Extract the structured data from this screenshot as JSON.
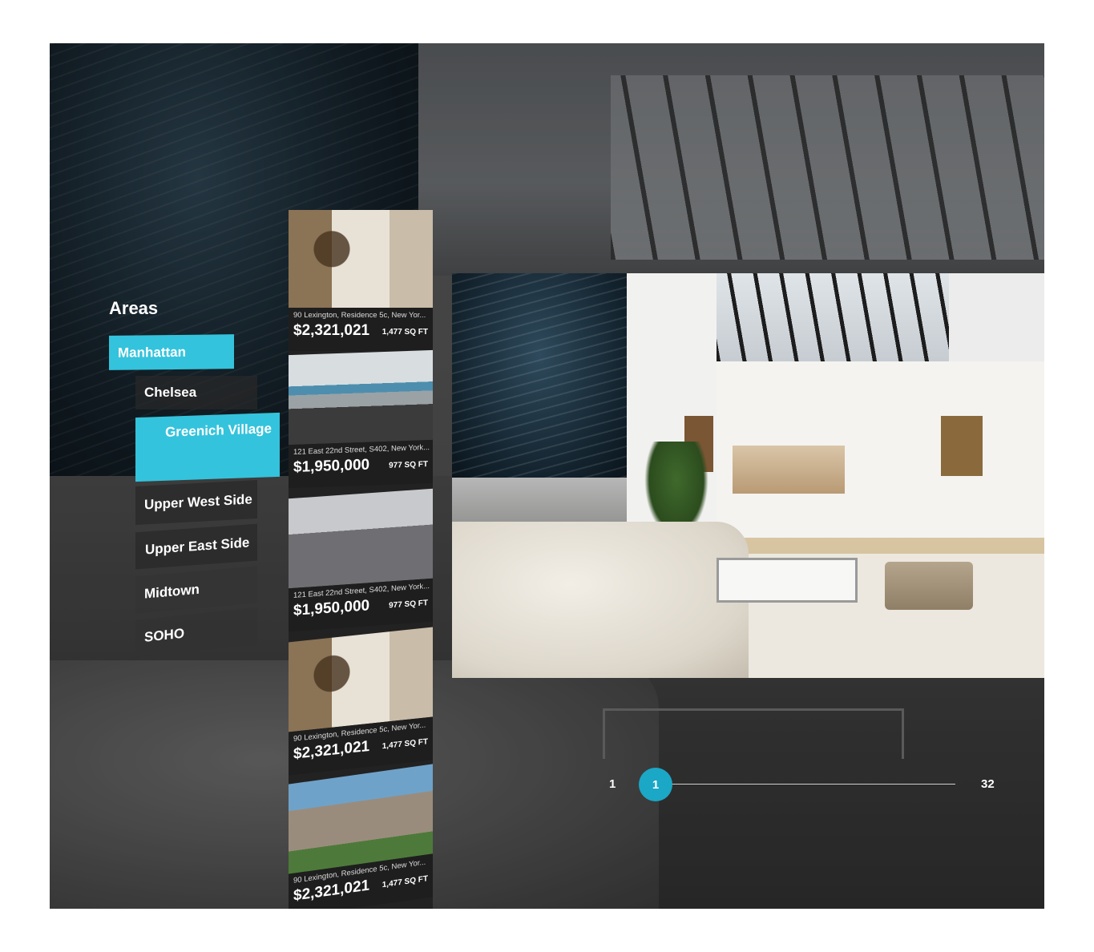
{
  "areas": {
    "title": "Areas",
    "items": [
      {
        "label": "Manhattan"
      },
      {
        "label": "Chelsea"
      },
      {
        "label": "Greenich Village"
      },
      {
        "label": "Upper West Side"
      },
      {
        "label": "Upper East Side"
      },
      {
        "label": "Midtown"
      },
      {
        "label": "SOHO"
      }
    ],
    "selected": [
      "Manhattan",
      "Greenich Village"
    ],
    "accent_color": "#34c3dc"
  },
  "listings": [
    {
      "address": "90 Lexington, Residence 5c, New Yor...",
      "price": "$2,321,021",
      "sqft": "1,477 SQ FT"
    },
    {
      "address": "121 East 22nd Street, S402, New York...",
      "price": "$1,950,000",
      "sqft": "977 SQ FT"
    },
    {
      "address": "121 East 22nd Street, S402, New York...",
      "price": "$1,950,000",
      "sqft": "977 SQ FT"
    },
    {
      "address": "90 Lexington, Residence 5c, New Yor...",
      "price": "$2,321,021",
      "sqft": "1,477 SQ FT"
    },
    {
      "address": "90 Lexington, Residence 5c, New Yor...",
      "price": "$2,321,021",
      "sqft": "1,477 SQ FT"
    }
  ],
  "pagination": {
    "first": "1",
    "current": "1",
    "last": "32",
    "knob_color": "#1ba7c6"
  }
}
